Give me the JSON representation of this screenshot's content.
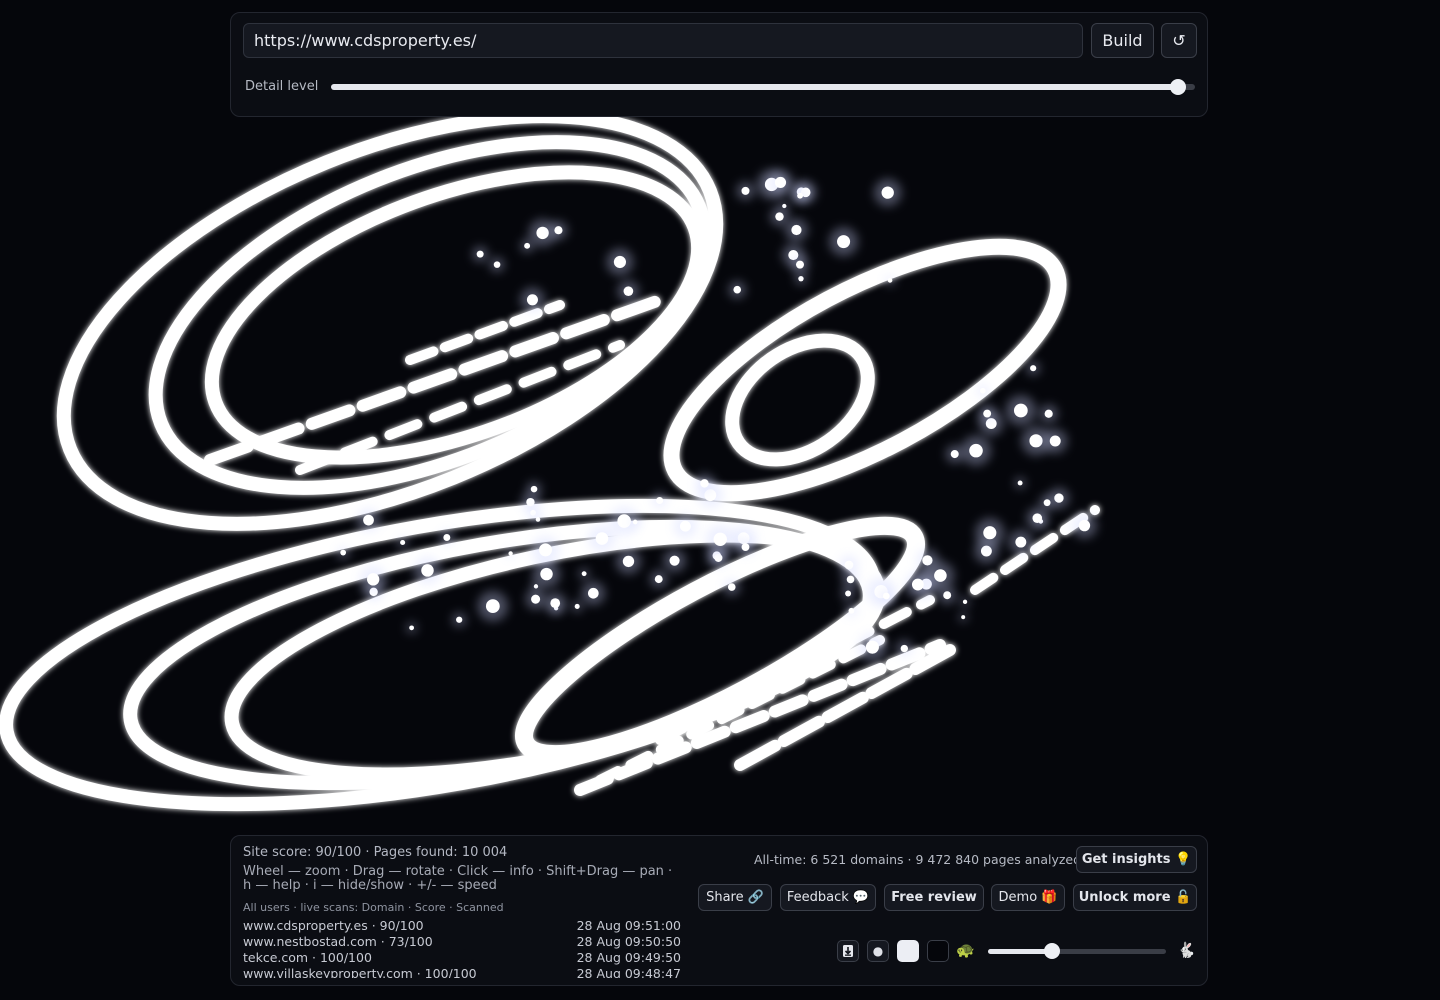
{
  "controls": {
    "url_value": "https://www.cdsproperty.es/",
    "build_label": "Build",
    "reset_icon": "↺",
    "detail_label": "Detail level",
    "detail_level": 0.98
  },
  "stats": {
    "site_line": "Site score: 90/100 · Pages found: 10 004",
    "help_line": "Wheel — zoom · Drag — rotate · Click — info · Shift+Drag — pan · h — help · i — hide/show · +/- — speed",
    "live_label": "All users · live scans: Domain · Score · Scanned",
    "alltime": "All-time: 6 521 domains · 9 472 840 pages analyzed"
  },
  "scans": [
    {
      "domain": "www.cdsproperty.es · 90/100",
      "time": "28 Aug 09:51:00"
    },
    {
      "domain": "www.nestbostad.com · 73/100",
      "time": "28 Aug 09:50:50"
    },
    {
      "domain": "tekce.com · 100/100",
      "time": "28 Aug 09:49:50"
    },
    {
      "domain": "www.villaskeyproperty.com · 100/100",
      "time": "28 Aug 09:48:47"
    }
  ],
  "buttons": {
    "insights": "Get insights 💡",
    "share": "Share 🔗",
    "feedback": "Feedback 💬",
    "review": "Free review",
    "demo": "Demo 🎁",
    "unlock": "Unlock more 🔓"
  },
  "tools": {
    "download_icon": "download-icon",
    "dot_icon": "●",
    "turtle": "🐢",
    "rabbit": "🐇",
    "speed_level": 0.36
  },
  "colors": {
    "background": "#05060b",
    "particle": "#ffffff",
    "panel": "#0b0d13"
  }
}
